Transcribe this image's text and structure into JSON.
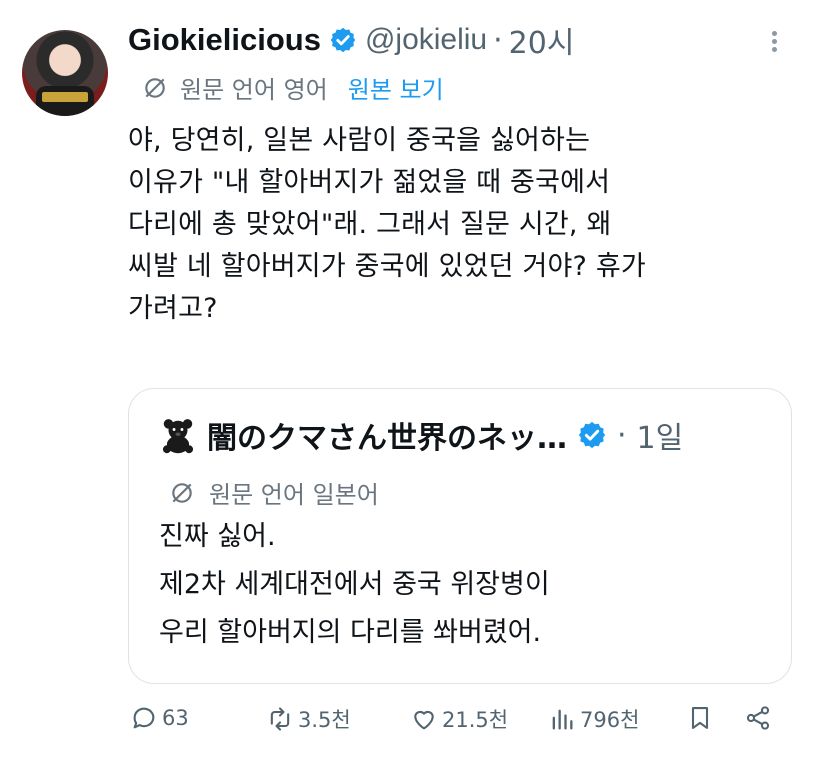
{
  "tweet": {
    "display_name": "Giokielicious",
    "handle": "@jokieliu",
    "separator": "·",
    "time": "20시",
    "translation": {
      "label": "원문 언어 영어",
      "view_original": "원본 보기"
    },
    "text_lines": [
      "야, 당연히, 일본 사람이 중국을 싫어하는",
      "이유가 \"내 할아버지가 젊었을 때 중국에서",
      "다리에 총 맞았어\"래. 그래서 질문 시간, 왜",
      "씨발 네 할아버지가 중국에 있었던 거야? 휴가",
      "가려고?"
    ]
  },
  "quote": {
    "display_name": "闇のクマさん世界のネッ…",
    "separator": "·",
    "time": "1일",
    "translation_label": "원문 언어 일본어",
    "text_lines": [
      "진짜 싫어.",
      "제2차 세계대전에서 중국 위장병이",
      "우리 할아버지의 다리를 쏴버렸어."
    ]
  },
  "actions": {
    "replies": "63",
    "reposts": "3.5천",
    "likes": "21.5천",
    "views": "796천"
  },
  "colors": {
    "accent": "#1d9bf0",
    "muted": "#536471",
    "text": "#0f1419",
    "border": "#dde3e8"
  },
  "icons": [
    "more-icon",
    "verified-badge-icon",
    "translate-icon",
    "bear-emoji-icon",
    "reply-icon",
    "repost-icon",
    "like-icon",
    "views-icon",
    "bookmark-icon",
    "share-icon"
  ]
}
